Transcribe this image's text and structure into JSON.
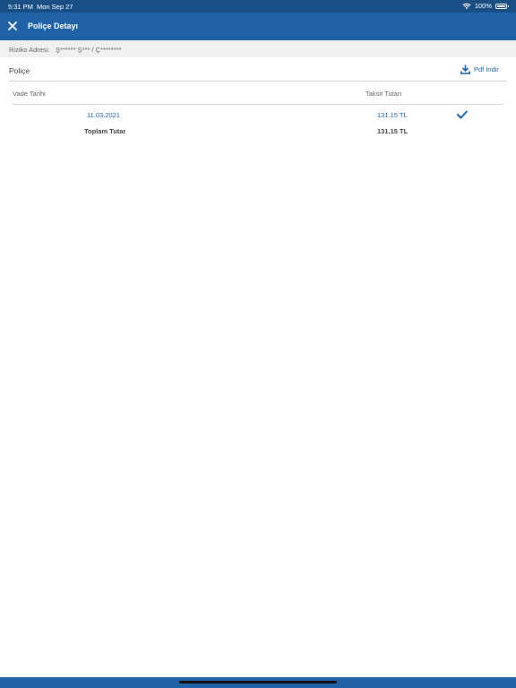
{
  "status": {
    "time": "5:31 PM",
    "date": "Mon Sep 27",
    "battery": "100%",
    "battery_level": 1.0
  },
  "nav": {
    "title": "Poliçe Detayı",
    "close_icon": "close-icon"
  },
  "address": {
    "label": "Riziko Adresi:",
    "value": "Ş****** Ş*** / Ç********"
  },
  "policy": {
    "title": "Poliçe",
    "pdf_label": "Pdf İndir",
    "pdf_icon": "download-icon"
  },
  "table": {
    "columns": [
      "Vade Tarihi",
      "Taksit Tutarı"
    ],
    "rows": [
      {
        "date": "11.03.2021",
        "amount": "131.15 TL",
        "paid_icon": "checkmark-icon"
      }
    ],
    "total": {
      "label": "Toplam Tutar",
      "amount": "131.15 TL"
    }
  },
  "colors": {
    "primary": "#1f62a8",
    "status_bar": "#1a4f86",
    "address_bg": "#f0f0f0"
  }
}
